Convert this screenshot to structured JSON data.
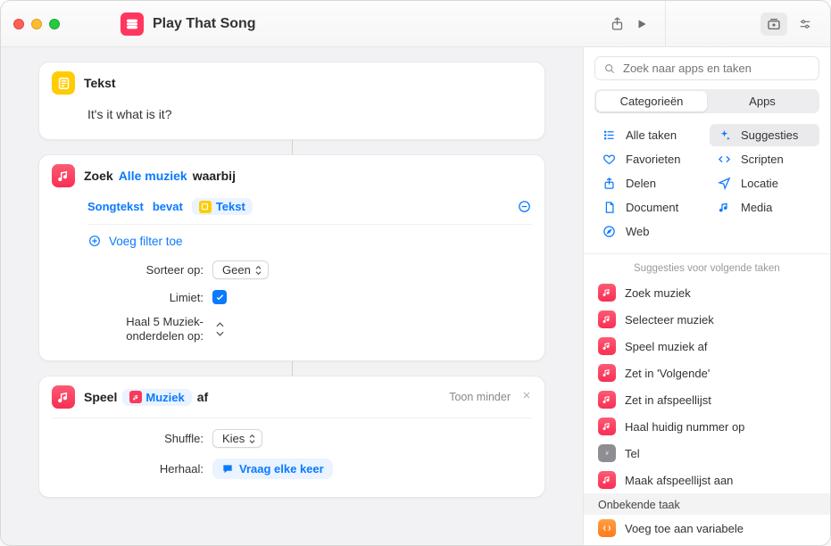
{
  "window": {
    "title": "Play That Song"
  },
  "actions": {
    "text": {
      "header": "Tekst",
      "value": "It's it what is it?"
    },
    "find": {
      "prefix": "Zoek",
      "scope": "Alle muziek",
      "suffix": "waarbij",
      "filter": {
        "field": "Songtekst",
        "op": "bevat",
        "variable": "Tekst"
      },
      "add_filter": "Voeg filter toe",
      "sort_label": "Sorteer op:",
      "sort_value": "Geen",
      "limit_label": "Limiet:",
      "limit_checked": true,
      "get_label_1": "Haal 5 Muziek-",
      "get_label_2": "onderdelen op:"
    },
    "play": {
      "prefix": "Speel",
      "variable": "Muziek",
      "suffix": "af",
      "show_less": "Toon minder",
      "shuffle_label": "Shuffle:",
      "shuffle_value": "Kies",
      "repeat_label": "Herhaal:",
      "repeat_value": "Vraag elke keer"
    }
  },
  "sidebar": {
    "search_placeholder": "Zoek naar apps en taken",
    "segments": {
      "categories": "Categorieën",
      "apps": "Apps"
    },
    "categories": [
      {
        "id": "all",
        "label": "Alle taken",
        "icon": "list"
      },
      {
        "id": "suggest",
        "label": "Suggesties",
        "icon": "sparkle",
        "selected": true
      },
      {
        "id": "fav",
        "label": "Favorieten",
        "icon": "heart"
      },
      {
        "id": "script",
        "label": "Scripten",
        "icon": "code"
      },
      {
        "id": "share",
        "label": "Delen",
        "icon": "share"
      },
      {
        "id": "location",
        "label": "Locatie",
        "icon": "nav"
      },
      {
        "id": "document",
        "label": "Document",
        "icon": "doc"
      },
      {
        "id": "media",
        "label": "Media",
        "icon": "music"
      },
      {
        "id": "web",
        "label": "Web",
        "icon": "safari"
      }
    ],
    "suggestions_header": "Suggesties voor volgende taken",
    "suggestions": [
      {
        "icon": "pink",
        "label": "Zoek muziek"
      },
      {
        "icon": "pink",
        "label": "Selecteer muziek"
      },
      {
        "icon": "pink",
        "label": "Speel muziek af"
      },
      {
        "icon": "pink",
        "label": "Zet in 'Volgende'"
      },
      {
        "icon": "pink",
        "label": "Zet in afspeellijst"
      },
      {
        "icon": "pink",
        "label": "Haal huidig nummer op"
      },
      {
        "icon": "gray",
        "label": "Tel"
      },
      {
        "icon": "pink",
        "label": "Maak afspeellijst aan"
      }
    ],
    "unknown_header": "Onbekende taak",
    "unknown_items": [
      {
        "icon": "orange",
        "label": "Voeg toe aan variabele"
      }
    ]
  }
}
